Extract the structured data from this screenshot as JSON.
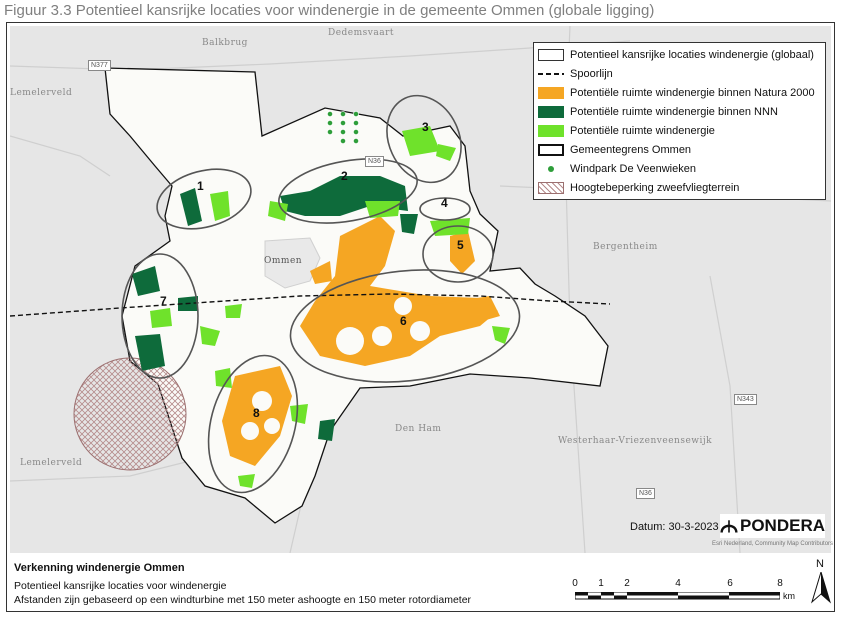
{
  "figure_title": "Figuur 3.3 Potentieel kansrijke locaties voor windenergie in de gemeente Ommen (globale ligging)",
  "legend": {
    "items": [
      {
        "label": "Potentieel kansrijke locaties windenergie (globaal)",
        "color": "#ffffff"
      },
      {
        "label": "Spoorlijn",
        "color": "#000000"
      },
      {
        "label": "Potentiële ruimte windenergie binnen Natura 2000",
        "color": "#f5a623"
      },
      {
        "label": "Potentiële ruimte windenergie binnen NNN",
        "color": "#0e6b3b"
      },
      {
        "label": "Potentiële ruimte windenergie",
        "color": "#6fe22b"
      },
      {
        "label": "Gemeentegrens Ommen",
        "color": "#000000"
      },
      {
        "label": "Windpark De Veenwieken",
        "color": "#2e9e3a"
      },
      {
        "label": "Hoogtebeperking zweefvliegterrein",
        "color": "#c9a8a8"
      }
    ]
  },
  "zones": [
    "1",
    "2",
    "3",
    "4",
    "5",
    "6",
    "7",
    "8"
  ],
  "places": {
    "dedemsvaart": "Dedemsvaart",
    "balkbrug": "Balkbrug",
    "lemelerveld_top": "Lemelerveld",
    "ommen": "Ommen",
    "bergentheim": "Bergentheim",
    "den_ham": "Den Ham",
    "westerhaar": "Westerhaar-Vriezenveensewijk",
    "lemelerveld": "Lemelerveld"
  },
  "roads": {
    "n377": "N377",
    "n36": "N36",
    "n343": "N343",
    "n36b": "N36"
  },
  "datum": "Datum: 30-3-2023",
  "logo": "PONDERA",
  "credits": "Esri Nederland, Community Map Contributors",
  "footer": {
    "title": "Verkenning windenergie Ommen",
    "line1": "Potentieel kansrijke locaties voor windenergie",
    "line2": "Afstanden zijn gebaseerd op een windturbine met 150 meter ashoogte en 150 meter rotordiameter"
  },
  "scale": {
    "ticks": [
      "0",
      "1",
      "2",
      "4",
      "6",
      "8"
    ],
    "unit": "km"
  },
  "north": "N",
  "colors": {
    "natura": "#f5a623",
    "nnn": "#0e6b3b",
    "ruimte": "#6fe22b",
    "background": "#e6e6e6",
    "municipality": "#fbfbf8"
  }
}
